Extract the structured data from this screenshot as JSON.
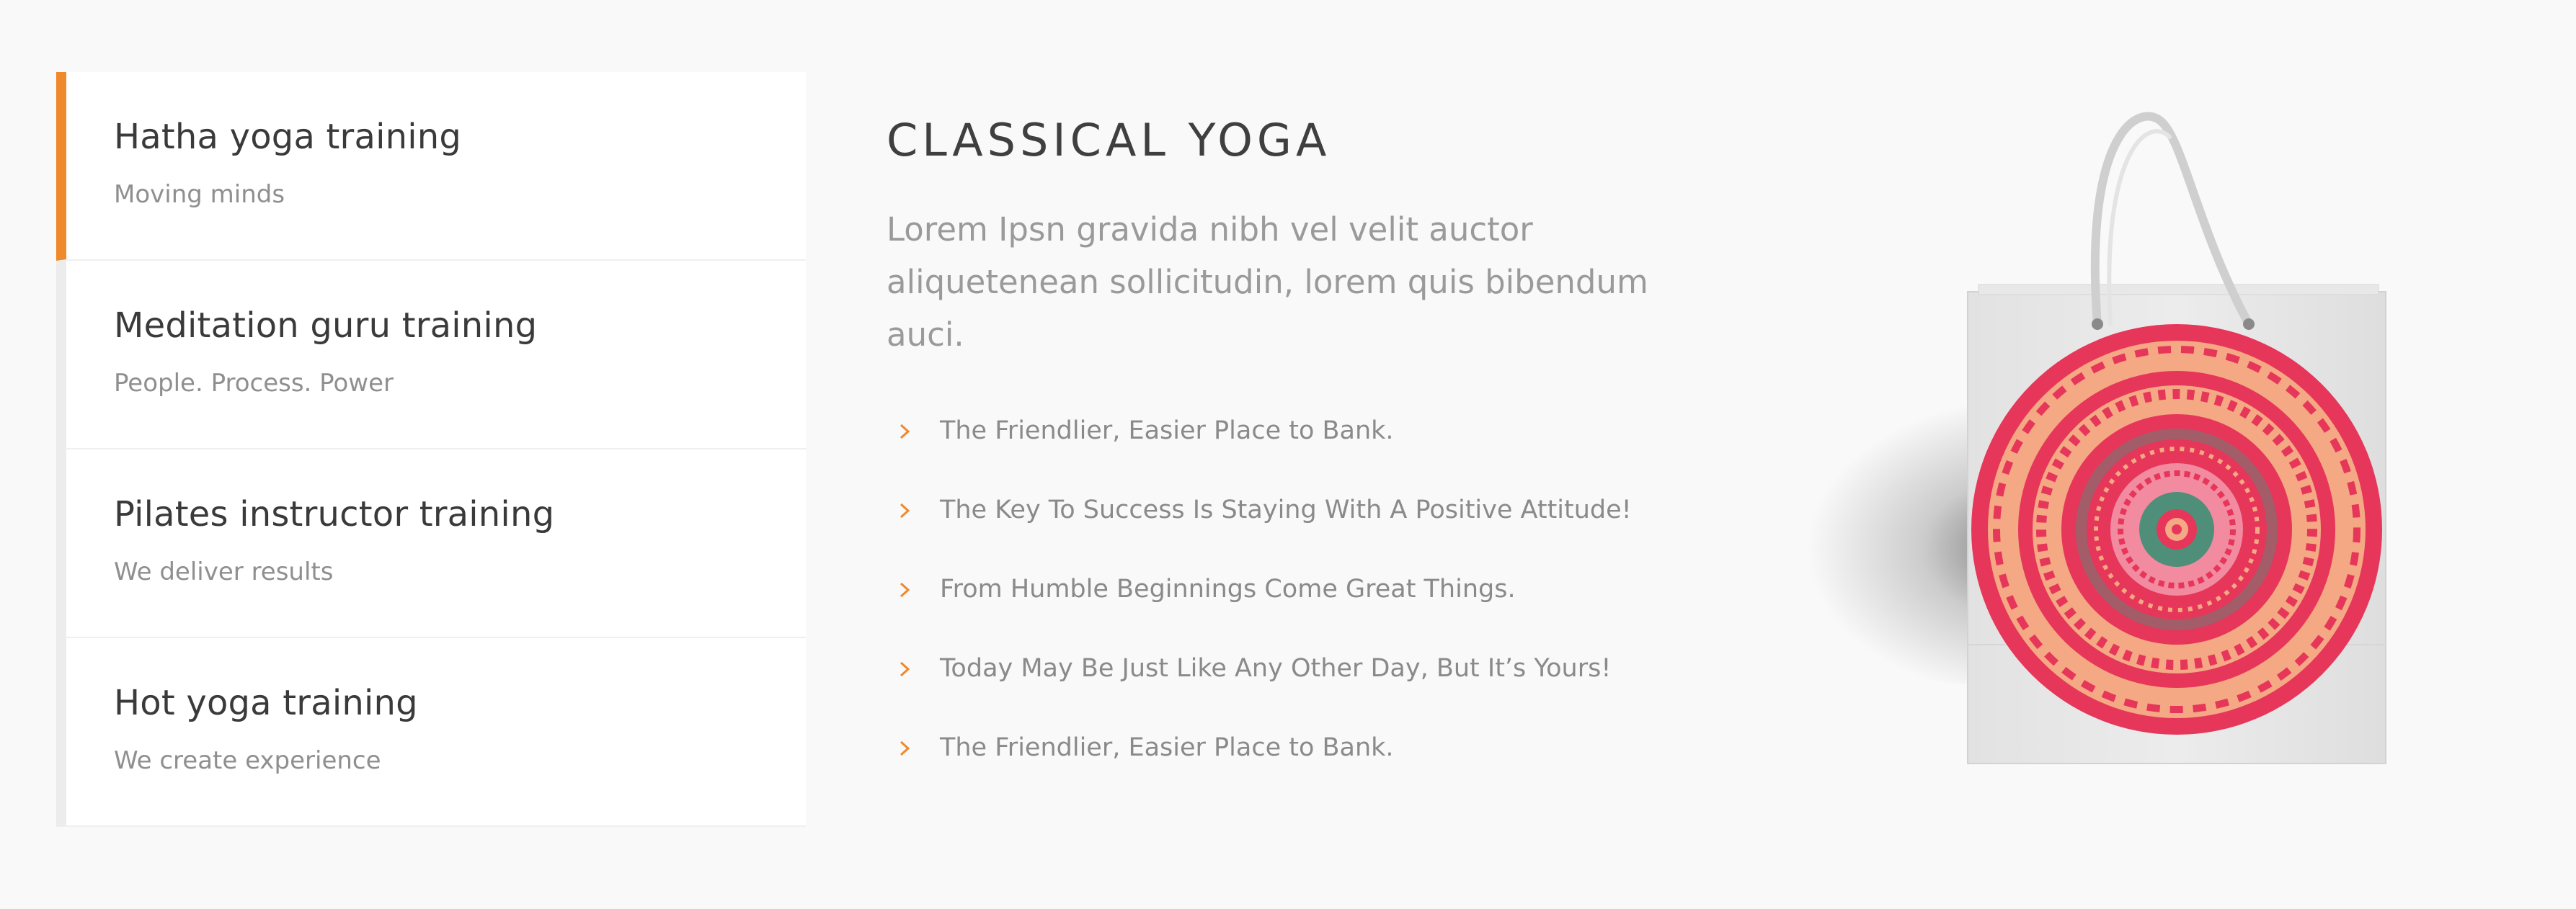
{
  "tabs": [
    {
      "title": "Hatha yoga training",
      "subtitle": "Moving minds",
      "active": true
    },
    {
      "title": "Meditation guru training",
      "subtitle": "People. Process. Power",
      "active": false
    },
    {
      "title": "Pilates instructor training",
      "subtitle": "We deliver results",
      "active": false
    },
    {
      "title": "Hot yoga training",
      "subtitle": "We create experience",
      "active": false
    }
  ],
  "content": {
    "heading": "CLASSICAL YOGA",
    "lead": "Lorem Ipsn gravida nibh vel velit auctor aliquetenean sollicitudin, lorem quis bibendum auci.",
    "features": [
      "The Friendlier, Easier Place to Bank.",
      "The Key To Success Is Staying With A Positive Attitude!",
      "From Humble Beginnings Come Great Things.",
      "Today May Be Just Like Any Other Day, But It’s Yours!",
      "The Friendlier, Easier Place to Bank."
    ]
  },
  "colors": {
    "accent": "#f0892b",
    "mandala_red": "#e6365a",
    "mandala_peach": "#f4a883",
    "mandala_teal": "#4f8f7a"
  },
  "icons": {
    "feature_bullet": "chevron-right-icon",
    "product_image": "shopping-bag-mandala-image"
  }
}
